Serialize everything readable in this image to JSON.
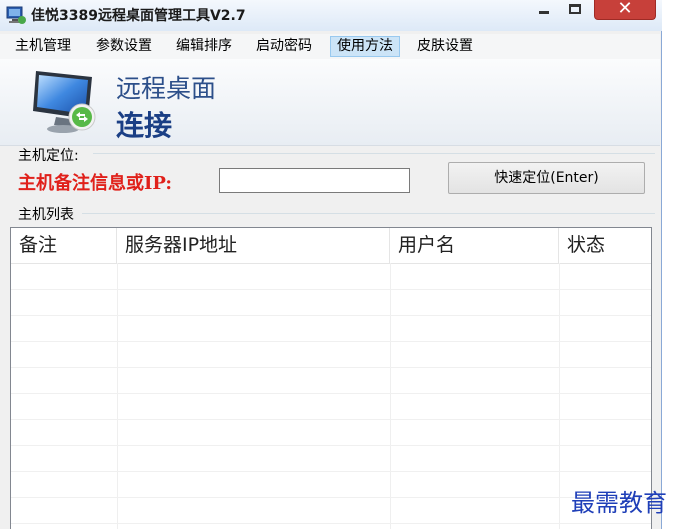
{
  "window": {
    "title": "佳悦3389远程桌面管理工具V2.7",
    "close_glyph": "✕"
  },
  "menu": {
    "items": [
      {
        "label": "主机管理"
      },
      {
        "label": "参数设置"
      },
      {
        "label": "编辑排序"
      },
      {
        "label": "启动密码"
      },
      {
        "label": "使用方法",
        "active": true
      },
      {
        "label": "皮肤设置"
      }
    ]
  },
  "banner": {
    "title_line1": "远程桌面",
    "title_line2": "连接",
    "icon": "remote-desktop-monitor-icon"
  },
  "locate": {
    "section_label": "主机定位:",
    "field_label": "主机备注信息或IP:",
    "input_value": "",
    "button_label": "快速定位(Enter)"
  },
  "host_list": {
    "section_label": "主机列表",
    "columns": [
      "备注",
      "服务器IP地址",
      "用户名",
      "状态"
    ],
    "rows": []
  },
  "watermark": "最需教育",
  "colors": {
    "accent_red": "#e0201a",
    "banner_blue": "#1b3f85",
    "close_red": "#c7403a",
    "active_menu": "#cce4f7"
  }
}
